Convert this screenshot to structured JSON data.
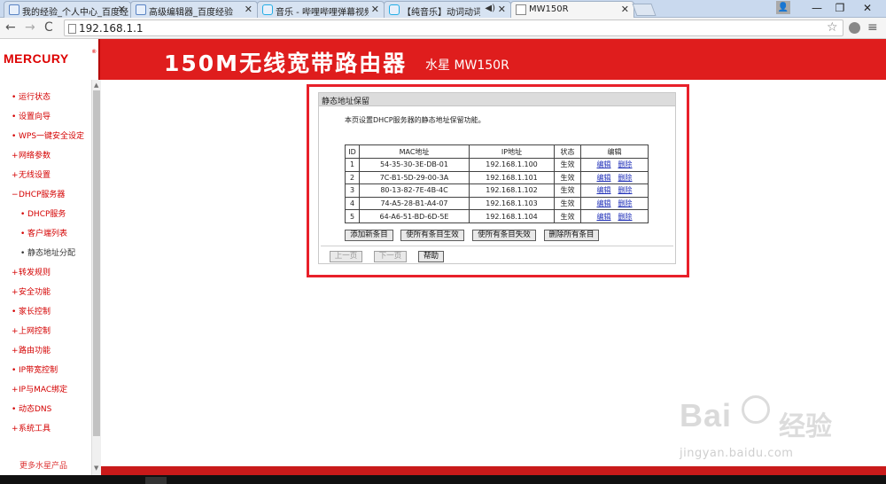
{
  "browser": {
    "tabs": [
      {
        "label": "我的经验_个人中心_百度经"
      },
      {
        "label": "高级编辑器_百度经验"
      },
      {
        "label": "音乐 - 哔哩哔哩弹幕视频网"
      },
      {
        "label": "【纯音乐】动词动词书"
      },
      {
        "label": "MW150R"
      }
    ],
    "url": "192.168.1.1",
    "window_controls": {
      "minimize": "—",
      "restore": "❐",
      "close": "✕"
    }
  },
  "header": {
    "brand": "MERCURY",
    "title": "150M无线宽带路由器",
    "model": "水星 MW150R"
  },
  "sidebar": {
    "items": [
      {
        "label": "运行状态"
      },
      {
        "label": "设置向导"
      },
      {
        "label": "WPS一键安全设定"
      },
      {
        "label": "网络参数"
      },
      {
        "label": "无线设置"
      },
      {
        "label": "DHCP服务器"
      },
      {
        "label": "DHCP服务"
      },
      {
        "label": "客户端列表"
      },
      {
        "label": "静态地址分配"
      },
      {
        "label": "转发规则"
      },
      {
        "label": "安全功能"
      },
      {
        "label": "家长控制"
      },
      {
        "label": "上网控制"
      },
      {
        "label": "路由功能"
      },
      {
        "label": "IP带宽控制"
      },
      {
        "label": "IP与MAC绑定"
      },
      {
        "label": "动态DNS"
      },
      {
        "label": "系统工具"
      }
    ],
    "bullets": {
      "plus": "+",
      "minus": "−",
      "dot": "•"
    },
    "cut_off_item": "更多水星产品"
  },
  "panel": {
    "title": "静态地址保留",
    "description": "本页设置DHCP服务器的静态地址保留功能。",
    "columns": [
      "ID",
      "MAC地址",
      "IP地址",
      "状态",
      "编辑"
    ],
    "rows": [
      {
        "id": "1",
        "mac": "54-35-30-3E-DB-01",
        "ip": "192.168.1.100",
        "status": "生效",
        "edit": "编辑",
        "delete": "删除"
      },
      {
        "id": "2",
        "mac": "7C-B1-5D-29-00-3A",
        "ip": "192.168.1.101",
        "status": "生效",
        "edit": "编辑",
        "delete": "删除"
      },
      {
        "id": "3",
        "mac": "80-13-82-7E-4B-4C",
        "ip": "192.168.1.102",
        "status": "生效",
        "edit": "编辑",
        "delete": "删除"
      },
      {
        "id": "4",
        "mac": "74-A5-28-B1-A4-07",
        "ip": "192.168.1.103",
        "status": "生效",
        "edit": "编辑",
        "delete": "删除"
      },
      {
        "id": "5",
        "mac": "64-A6-51-BD-6D-5E",
        "ip": "192.168.1.104",
        "status": "生效",
        "edit": "编辑",
        "delete": "删除"
      }
    ],
    "buttons": {
      "add": "添加新条目",
      "enable_all": "使所有条目生效",
      "disable_all": "使所有条目失效",
      "delete_all": "删除所有条目",
      "prev": "上一页",
      "next": "下一页",
      "help": "帮助"
    }
  },
  "watermark": {
    "brand_left": "Bai",
    "brand_right": "经验",
    "url": "jingyan.baidu.com"
  },
  "colors": {
    "header_red": "#df1d1d",
    "sidebar_text": "#d40000",
    "highlight_box": "#e8202a",
    "link_blue": "#1f2fb8"
  }
}
